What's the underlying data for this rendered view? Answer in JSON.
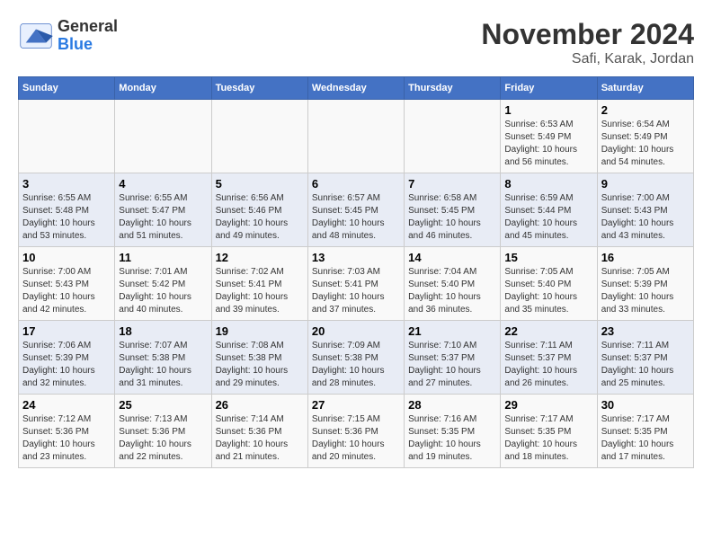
{
  "logo": {
    "general": "General",
    "blue": "Blue"
  },
  "title": "November 2024",
  "subtitle": "Safi, Karak, Jordan",
  "days_of_week": [
    "Sunday",
    "Monday",
    "Tuesday",
    "Wednesday",
    "Thursday",
    "Friday",
    "Saturday"
  ],
  "weeks": [
    [
      {
        "day": "",
        "info": ""
      },
      {
        "day": "",
        "info": ""
      },
      {
        "day": "",
        "info": ""
      },
      {
        "day": "",
        "info": ""
      },
      {
        "day": "",
        "info": ""
      },
      {
        "day": "1",
        "info": "Sunrise: 6:53 AM\nSunset: 5:49 PM\nDaylight: 10 hours and 56 minutes."
      },
      {
        "day": "2",
        "info": "Sunrise: 6:54 AM\nSunset: 5:49 PM\nDaylight: 10 hours and 54 minutes."
      }
    ],
    [
      {
        "day": "3",
        "info": "Sunrise: 6:55 AM\nSunset: 5:48 PM\nDaylight: 10 hours and 53 minutes."
      },
      {
        "day": "4",
        "info": "Sunrise: 6:55 AM\nSunset: 5:47 PM\nDaylight: 10 hours and 51 minutes."
      },
      {
        "day": "5",
        "info": "Sunrise: 6:56 AM\nSunset: 5:46 PM\nDaylight: 10 hours and 49 minutes."
      },
      {
        "day": "6",
        "info": "Sunrise: 6:57 AM\nSunset: 5:45 PM\nDaylight: 10 hours and 48 minutes."
      },
      {
        "day": "7",
        "info": "Sunrise: 6:58 AM\nSunset: 5:45 PM\nDaylight: 10 hours and 46 minutes."
      },
      {
        "day": "8",
        "info": "Sunrise: 6:59 AM\nSunset: 5:44 PM\nDaylight: 10 hours and 45 minutes."
      },
      {
        "day": "9",
        "info": "Sunrise: 7:00 AM\nSunset: 5:43 PM\nDaylight: 10 hours and 43 minutes."
      }
    ],
    [
      {
        "day": "10",
        "info": "Sunrise: 7:00 AM\nSunset: 5:43 PM\nDaylight: 10 hours and 42 minutes."
      },
      {
        "day": "11",
        "info": "Sunrise: 7:01 AM\nSunset: 5:42 PM\nDaylight: 10 hours and 40 minutes."
      },
      {
        "day": "12",
        "info": "Sunrise: 7:02 AM\nSunset: 5:41 PM\nDaylight: 10 hours and 39 minutes."
      },
      {
        "day": "13",
        "info": "Sunrise: 7:03 AM\nSunset: 5:41 PM\nDaylight: 10 hours and 37 minutes."
      },
      {
        "day": "14",
        "info": "Sunrise: 7:04 AM\nSunset: 5:40 PM\nDaylight: 10 hours and 36 minutes."
      },
      {
        "day": "15",
        "info": "Sunrise: 7:05 AM\nSunset: 5:40 PM\nDaylight: 10 hours and 35 minutes."
      },
      {
        "day": "16",
        "info": "Sunrise: 7:05 AM\nSunset: 5:39 PM\nDaylight: 10 hours and 33 minutes."
      }
    ],
    [
      {
        "day": "17",
        "info": "Sunrise: 7:06 AM\nSunset: 5:39 PM\nDaylight: 10 hours and 32 minutes."
      },
      {
        "day": "18",
        "info": "Sunrise: 7:07 AM\nSunset: 5:38 PM\nDaylight: 10 hours and 31 minutes."
      },
      {
        "day": "19",
        "info": "Sunrise: 7:08 AM\nSunset: 5:38 PM\nDaylight: 10 hours and 29 minutes."
      },
      {
        "day": "20",
        "info": "Sunrise: 7:09 AM\nSunset: 5:38 PM\nDaylight: 10 hours and 28 minutes."
      },
      {
        "day": "21",
        "info": "Sunrise: 7:10 AM\nSunset: 5:37 PM\nDaylight: 10 hours and 27 minutes."
      },
      {
        "day": "22",
        "info": "Sunrise: 7:11 AM\nSunset: 5:37 PM\nDaylight: 10 hours and 26 minutes."
      },
      {
        "day": "23",
        "info": "Sunrise: 7:11 AM\nSunset: 5:37 PM\nDaylight: 10 hours and 25 minutes."
      }
    ],
    [
      {
        "day": "24",
        "info": "Sunrise: 7:12 AM\nSunset: 5:36 PM\nDaylight: 10 hours and 23 minutes."
      },
      {
        "day": "25",
        "info": "Sunrise: 7:13 AM\nSunset: 5:36 PM\nDaylight: 10 hours and 22 minutes."
      },
      {
        "day": "26",
        "info": "Sunrise: 7:14 AM\nSunset: 5:36 PM\nDaylight: 10 hours and 21 minutes."
      },
      {
        "day": "27",
        "info": "Sunrise: 7:15 AM\nSunset: 5:36 PM\nDaylight: 10 hours and 20 minutes."
      },
      {
        "day": "28",
        "info": "Sunrise: 7:16 AM\nSunset: 5:35 PM\nDaylight: 10 hours and 19 minutes."
      },
      {
        "day": "29",
        "info": "Sunrise: 7:17 AM\nSunset: 5:35 PM\nDaylight: 10 hours and 18 minutes."
      },
      {
        "day": "30",
        "info": "Sunrise: 7:17 AM\nSunset: 5:35 PM\nDaylight: 10 hours and 17 minutes."
      }
    ]
  ]
}
